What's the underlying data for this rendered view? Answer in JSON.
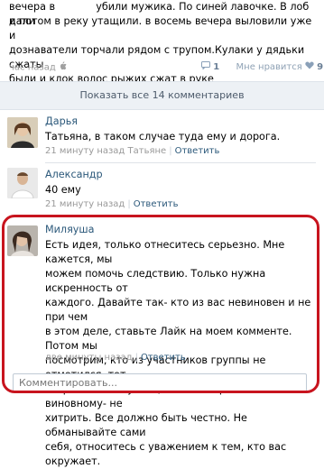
{
  "post": {
    "text_line1_a": "вечера в",
    "text_line1_b": "убили мужика. По синей лавочке. В лоб дали",
    "text_line2": "и потом в реку утащили. в восемь вечера выловили уже и",
    "text_line3": "дознаватели торчали рядом с трупом.Кулаки у дядьки сжаты",
    "text_line4": "были и клок волос рыжих сжат в руке",
    "time": "час назад",
    "platform_icon": "apple-icon",
    "comments_count": "1",
    "like_label": "Мне нравится",
    "like_icon": "heart-icon",
    "likes_count": "9"
  },
  "show_all_label": "Показать все 14 комментариев",
  "comments": [
    {
      "name": "Дарья",
      "text": "Татьяна, в таком случае туда ему и дорога.",
      "time": "21 минуту назад Татьяне",
      "reply": "Ответить"
    },
    {
      "name": "Александр",
      "text": "40 ему",
      "time": "21 минуту назад",
      "reply": "Ответить"
    },
    {
      "name": "Миляуша",
      "lines": [
        "Есть идея, только отнеситесь серьезно. Мне кажется, мы",
        "можем помочь следствию. Только нужна искренность от",
        "каждого. Давайте так- кто из вас невиновен и не при чем",
        "в этом деле, ставьте Лайк на моем комменте. Потом мы",
        "посмотрим, кто из участников группы не отметился, тот",
        "скорей всего и убийца. Только просьба к виновному- не",
        "хитрить. Все должно быть честно. Не обманывайте сами",
        "себя, относитесь с уважением к тем, кто вас окружает."
      ],
      "time": "две минуты назад",
      "reply": "Ответить"
    }
  ],
  "comment_placeholder": "Комментировать..."
}
